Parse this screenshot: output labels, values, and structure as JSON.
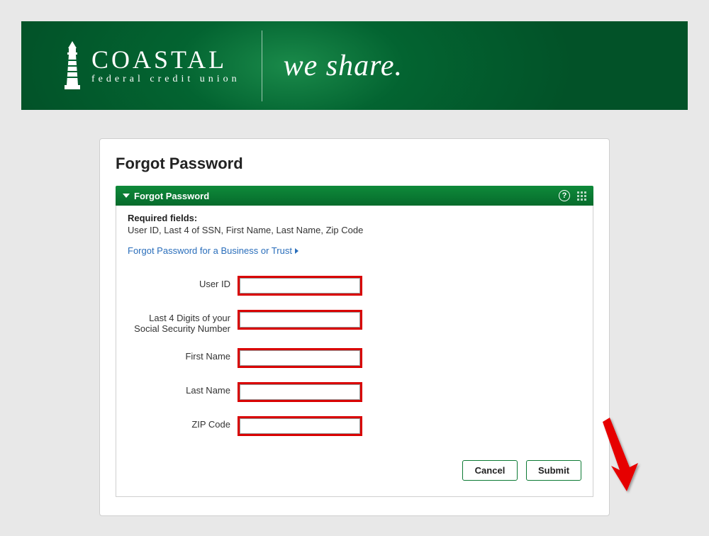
{
  "banner": {
    "brand_main": "COASTAL",
    "brand_sub": "federal credit union",
    "tagline": "we share."
  },
  "page": {
    "title": "Forgot Password"
  },
  "panel": {
    "header": "Forgot Password",
    "required_label": "Required fields:",
    "required_list": "User ID, Last 4 of SSN, First Name, Last Name, Zip Code",
    "business_link": "Forgot Password for a Business or Trust"
  },
  "form": {
    "fields": [
      {
        "label": "User ID",
        "value": ""
      },
      {
        "label": "Last 4 Digits of your Social Security Number",
        "value": ""
      },
      {
        "label": "First Name",
        "value": ""
      },
      {
        "label": "Last Name",
        "value": ""
      },
      {
        "label": "ZIP Code",
        "value": ""
      }
    ]
  },
  "buttons": {
    "cancel": "Cancel",
    "submit": "Submit"
  }
}
